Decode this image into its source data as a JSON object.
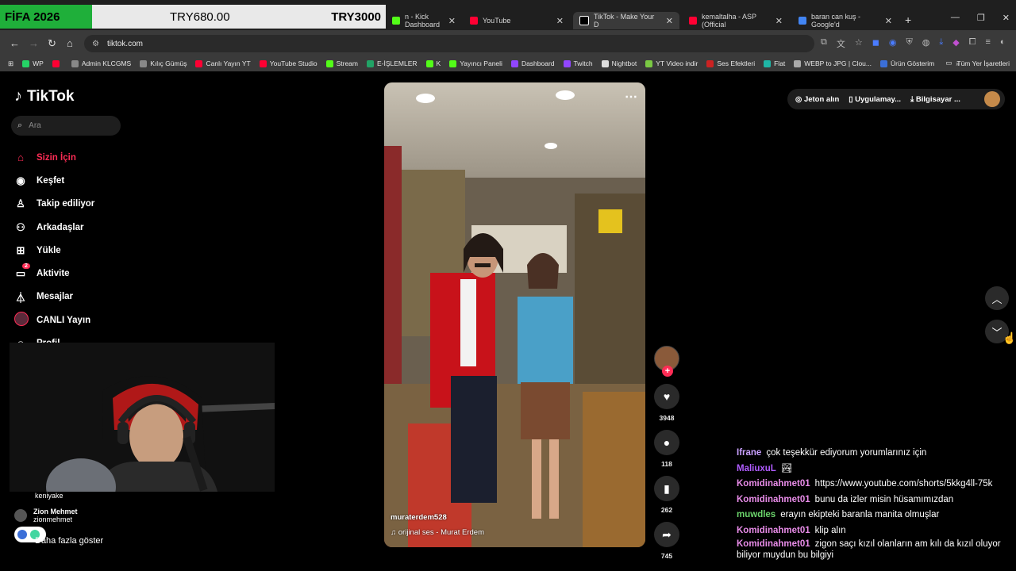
{
  "overlay": {
    "tag": "FİFA 2026",
    "price1": "TRY680.00",
    "price2": "TRY3000"
  },
  "tabs": [
    {
      "title": "n - Kick Dashboard",
      "color": "#53fc18"
    },
    {
      "title": "YouTube",
      "color": "#ff0033"
    },
    {
      "title": "TikTok - Make Your D",
      "color": "#000000"
    },
    {
      "title": "kemaltalha - ASP (Official",
      "color": "#ff0033"
    },
    {
      "title": "baran can kuş - Google'd",
      "color": "#4285f4"
    }
  ],
  "address": {
    "url": "tiktok.com"
  },
  "bookmarks": [
    {
      "label": "WP",
      "color": "#25d366"
    },
    {
      "label": "",
      "color": "#ff0033"
    },
    {
      "label": "Admin KLCGMS",
      "color": "#888888"
    },
    {
      "label": "Kılıç Gümüş",
      "color": "#888888"
    },
    {
      "label": "Canlı Yayın YT",
      "color": "#ff0033"
    },
    {
      "label": "YouTube Studio",
      "color": "#ff0033"
    },
    {
      "label": "Stream",
      "color": "#53fc18"
    },
    {
      "label": "E-İŞLEMLER",
      "color": "#21a366"
    },
    {
      "label": "K",
      "color": "#53fc18"
    },
    {
      "label": "Yayıncı Paneli",
      "color": "#53fc18"
    },
    {
      "label": "Dashboard",
      "color": "#9146ff"
    },
    {
      "label": "Twitch",
      "color": "#9146ff"
    },
    {
      "label": "Nightbot",
      "color": "#dddddd"
    },
    {
      "label": "YT Video indir",
      "color": "#7ac943"
    },
    {
      "label": "Ses Efektleri",
      "color": "#cc2222"
    },
    {
      "label": "Flat",
      "color": "#1fb6a6"
    },
    {
      "label": "WEBP to JPG | Clou...",
      "color": "#aaaaaa"
    },
    {
      "label": "Ürün Gösterim",
      "color": "#3b6fd8"
    }
  ],
  "bookmarks_right": "Tüm Yer İşaretleri",
  "tiktok": {
    "logo": "TikTok",
    "search_placeholder": "Ara",
    "nav": [
      {
        "label": "Sizin İçin",
        "icon": "home-icon",
        "active": true
      },
      {
        "label": "Keşfet",
        "icon": "compass-icon"
      },
      {
        "label": "Takip ediliyor",
        "icon": "following-icon"
      },
      {
        "label": "Arkadaşlar",
        "icon": "friends-icon"
      },
      {
        "label": "Yükle",
        "icon": "upload-icon"
      },
      {
        "label": "Aktivite",
        "icon": "activity-icon",
        "badge": "2"
      },
      {
        "label": "Mesajlar",
        "icon": "messages-icon"
      },
      {
        "label": "CANLI Yayın",
        "icon": "live-icon"
      },
      {
        "label": "Profil",
        "icon": "profile-icon"
      }
    ],
    "following": [
      {
        "name": "",
        "handle": "keniyake"
      },
      {
        "name": "Zion Mehmet",
        "handle": "zionmehmet"
      }
    ],
    "show_more": "Daha fazla göster",
    "top_right": {
      "coins": "Jeton alın",
      "app": "Uygulamay...",
      "pc": "Bilgisayar ..."
    },
    "video": {
      "username": "muraterdem528",
      "sound": "orijinal ses - Murat Erdem",
      "likes": "3948",
      "comments": "118",
      "saves": "262",
      "shares": "745"
    }
  },
  "chat": [
    {
      "user": "Ifrane",
      "color": "#c9a0ff",
      "text": "çok teşekkür ediyorum yorumlarınız için"
    },
    {
      "user": "MaliuxuL",
      "color": "#b05cff",
      "text": "🏞"
    },
    {
      "user": "Komidinahmet01",
      "color": "#e88ce8",
      "text": "https://www.youtube.com/shorts/5kkg4ll-75k"
    },
    {
      "user": "Komidinahmet01",
      "color": "#e88ce8",
      "text": "bunu da izler misin hüsamımızdan"
    },
    {
      "user": "muwdles",
      "color": "#6bd46b",
      "text": "erayın ekipteki baranla manita olmuşlar"
    },
    {
      "user": "Komidinahmet01",
      "color": "#e88ce8",
      "text": "klip alın"
    },
    {
      "user": "Komidinahmet01",
      "color": "#e88ce8",
      "text": "zigon saçı kızıl olanların am kılı da kızıl oluyor biliyor muydun bu bilgiyi"
    }
  ]
}
